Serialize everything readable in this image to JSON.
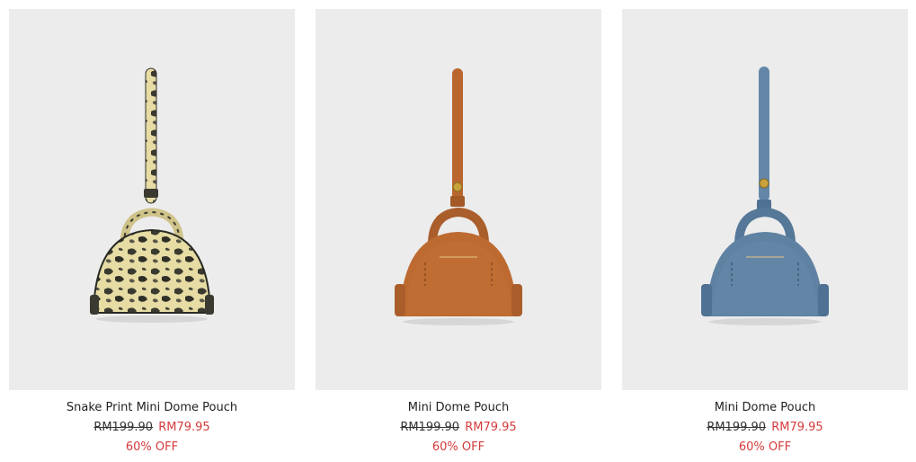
{
  "colors": {
    "card_background": "#ececec",
    "sale_red": "#d53a3a",
    "text_dark": "#222222"
  },
  "products": [
    {
      "name": "Snake Print Mini Dome Pouch",
      "original_price": "RM199.90",
      "sale_price": "RM79.95",
      "discount": "60% OFF",
      "image_icon": "snake-print-pouch-image",
      "bag_color": "#e4d9a0"
    },
    {
      "name": "Mini Dome Pouch",
      "original_price": "RM199.90",
      "sale_price": "RM79.95",
      "discount": "60% OFF",
      "image_icon": "tan-pouch-image",
      "bag_color": "#b9672f"
    },
    {
      "name": "Mini Dome Pouch",
      "original_price": "RM199.90",
      "sale_price": "RM79.95",
      "discount": "60% OFF",
      "image_icon": "blue-pouch-image",
      "bag_color": "#5d7f9f"
    }
  ]
}
